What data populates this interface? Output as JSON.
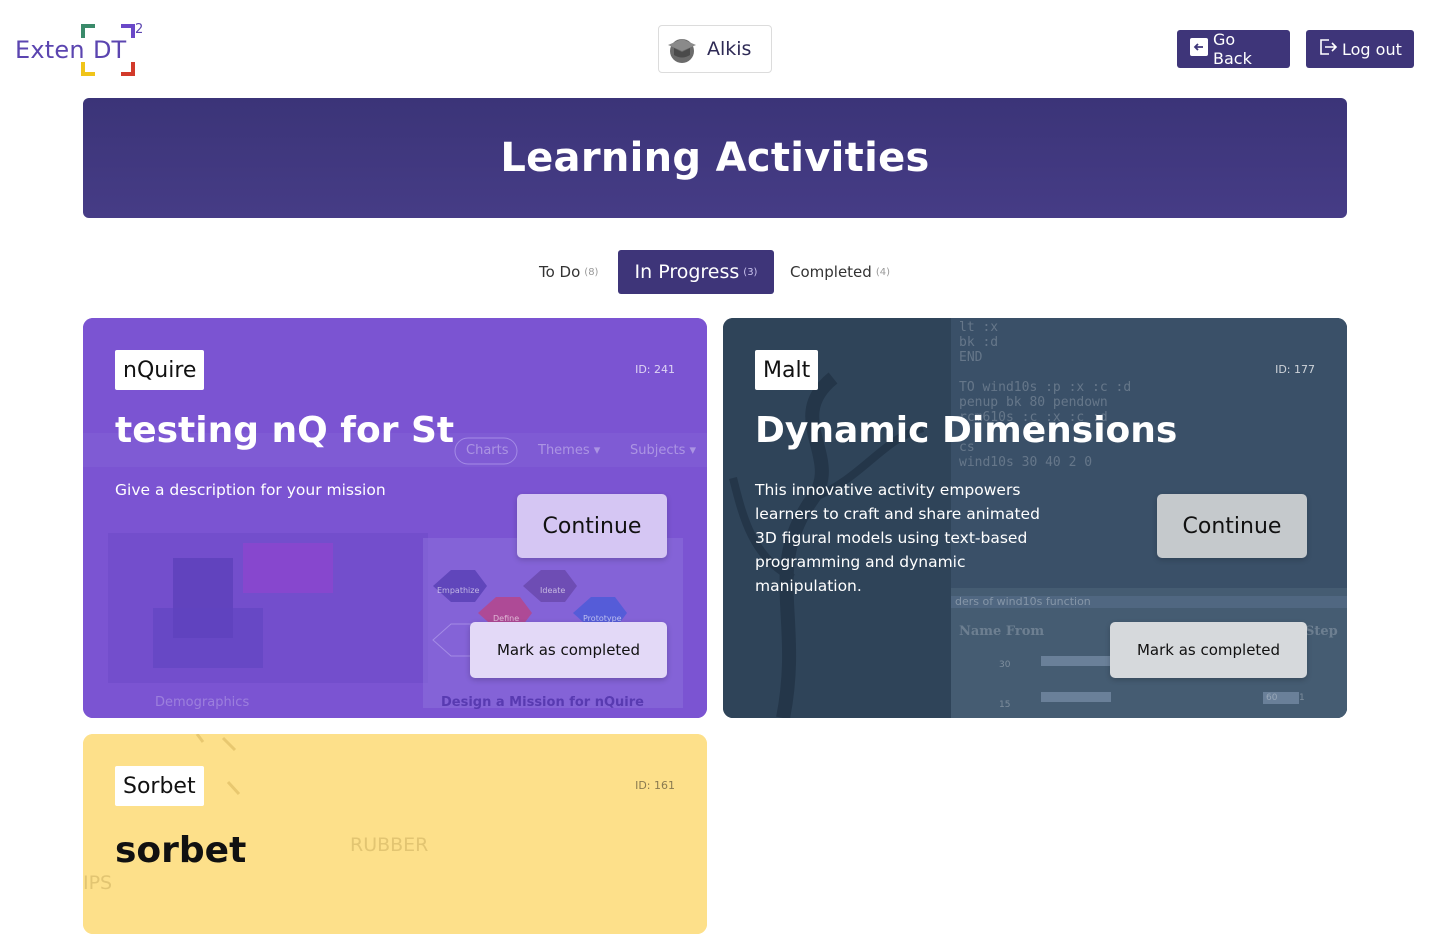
{
  "header": {
    "logo_text": "Exten",
    "logo_dt": "DT",
    "logo_sup": "2",
    "user_name": "Alkis",
    "go_back_label": "Go Back",
    "logout_label": "Log out"
  },
  "banner": {
    "title": "Learning Activities"
  },
  "tabs": [
    {
      "label": "To Do",
      "count": "(8)",
      "active": false
    },
    {
      "label": "In Progress",
      "count": "(3)",
      "active": true
    },
    {
      "label": "Completed",
      "count": "(4)",
      "active": false
    }
  ],
  "cards": [
    {
      "tag": "nQuire",
      "id": "ID: 241",
      "title": "testing nQ for St",
      "description": "Give a description for your mission",
      "continue_label": "Continue",
      "complete_label": "Mark as completed",
      "bg_text": [
        "Themes ▾",
        "Subjects ▾",
        "Charts",
        "Demographics",
        "Design a Mission for nQuire",
        "Empathize",
        "Ideate",
        "Define",
        "Prototype"
      ]
    },
    {
      "tag": "Malt",
      "id": "ID: 177",
      "title": "Dynamic Dimensions",
      "description": "This innovative activity empowers learners to craft and share animated 3D figural models using text-based programming and dynamic manipulation.",
      "continue_label": "Continue",
      "complete_label": "Mark as completed",
      "bg_code": "lt :x\nbk :d\nEND\n\nTO wind10s :p :x :c :d\npenup bk 80 pendown\nrcm610s :c :x :c :d\n\ncs\nwind10s 30 40 2 0",
      "bg_text": [
        "Name From",
        "Step",
        "30",
        "15",
        "60",
        "1",
        "ders of wind10s function"
      ]
    },
    {
      "tag": "Sorbet",
      "id": "ID: 161",
      "title": "sorbet",
      "bg_text": [
        "RUBBER",
        "IPS"
      ]
    }
  ],
  "colors": {
    "primary": "#3e3579",
    "card_nquire": "#7a52d1",
    "card_malt": "#2e4358",
    "card_sorbet": "#fde08a"
  }
}
